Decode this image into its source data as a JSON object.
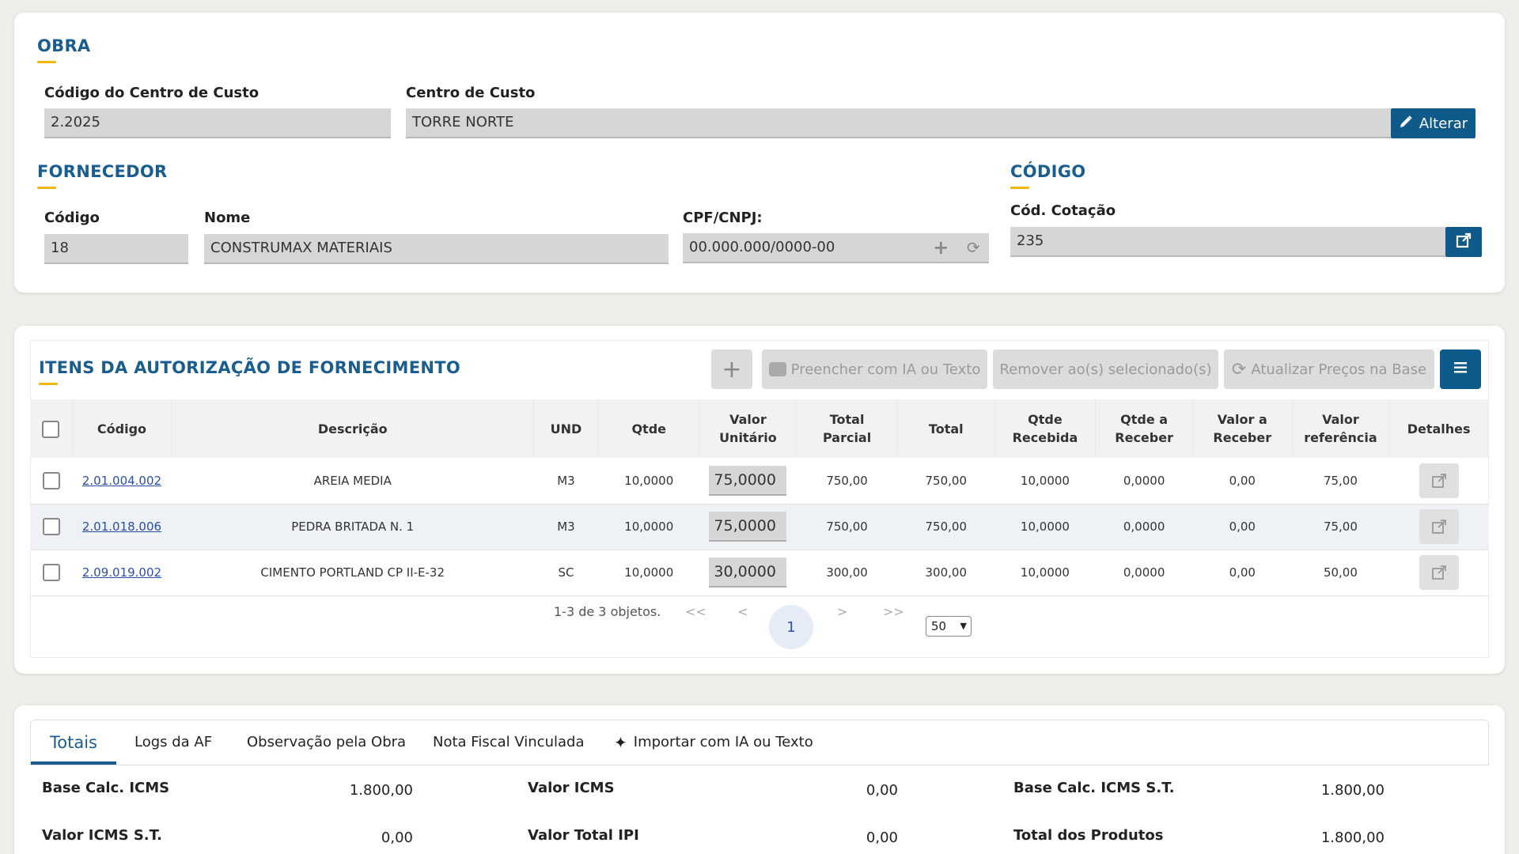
{
  "obra": {
    "title": "OBRA",
    "codigo_label": "Código do Centro de Custo",
    "codigo_value": "2.2025",
    "centro_label": "Centro de Custo",
    "centro_value": "TORRE NORTE",
    "alterar_label": "Alterar"
  },
  "fornecedor": {
    "title": "FORNECEDOR",
    "codigo_label": "Código",
    "codigo_value": "18",
    "nome_label": "Nome",
    "nome_value": "CONSTRUMAX MATERIAIS",
    "cpf_label": "CPF/CNPJ:",
    "cpf_value": "00.000.000/0000-00"
  },
  "codigo": {
    "title": "CÓDIGO",
    "cotacao_label": "Cód. Cotação",
    "cotacao_value": "235"
  },
  "itens": {
    "title": "ITENS DA AUTORIZAÇÃO DE FORNECIMENTO",
    "toolbar": {
      "add_label": "+",
      "ia_label": "Preencher com IA ou Texto",
      "remove_label": "Remover ao(s) selecionado(s)",
      "update_label": "Atualizar Preços na Base"
    },
    "columns": [
      "Código",
      "Descrição",
      "UND",
      "Qtde",
      "Valor Unitário",
      "Total Parcial",
      "Total",
      "Qtde Recebida",
      "Qtde a Receber",
      "Valor a Receber",
      "Valor referência",
      "Detalhes"
    ],
    "rows": [
      {
        "codigo": "2.01.004.002",
        "descricao": "AREIA MEDIA",
        "und": "M3",
        "qtde": "10,0000",
        "valor_unitario": "75,0000",
        "total_parcial": "750,00",
        "total": "750,00",
        "qtde_recebida": "10,0000",
        "qtde_a_receber": "0,0000",
        "valor_a_receber": "0,00",
        "valor_referencia": "75,00"
      },
      {
        "codigo": "2.01.018.006",
        "descricao": "PEDRA BRITADA N. 1",
        "und": "M3",
        "qtde": "10,0000",
        "valor_unitario": "75,0000",
        "total_parcial": "750,00",
        "total": "750,00",
        "qtde_recebida": "10,0000",
        "qtde_a_receber": "0,0000",
        "valor_a_receber": "0,00",
        "valor_referencia": "75,00"
      },
      {
        "codigo": "2.09.019.002",
        "descricao": "CIMENTO PORTLAND CP II-E-32",
        "und": "SC",
        "qtde": "10,0000",
        "valor_unitario": "30,0000",
        "total_parcial": "300,00",
        "total": "300,00",
        "qtde_recebida": "10,0000",
        "qtde_a_receber": "0,0000",
        "valor_a_receber": "0,00",
        "valor_referencia": "50,00"
      }
    ],
    "pagination": {
      "summary": "1-3 de 3 objetos.",
      "first": "<<",
      "prev": "<",
      "current": "1",
      "next": ">",
      "last": ">>",
      "page_size": "50"
    }
  },
  "tabs": [
    "Totais",
    "Logs da AF",
    "Observação pela Obra",
    "Nota Fiscal Vinculada",
    "Importar com IA ou Texto"
  ],
  "totais": [
    {
      "label": "Base Calc. ICMS",
      "value": "1.800,00"
    },
    {
      "label": "Valor ICMS",
      "value": "0,00"
    },
    {
      "label": "Base Calc. ICMS S.T.",
      "value": "1.800,00"
    },
    {
      "label": "Valor ICMS S.T.",
      "value": "0,00"
    },
    {
      "label": "Valor Total IPI",
      "value": "0,00"
    },
    {
      "label": "Total dos Produtos",
      "value": "1.800,00"
    }
  ],
  "colors": {
    "accent": "#1a5d8f",
    "underline": "#f2b705",
    "button": "#0e5a8a"
  }
}
